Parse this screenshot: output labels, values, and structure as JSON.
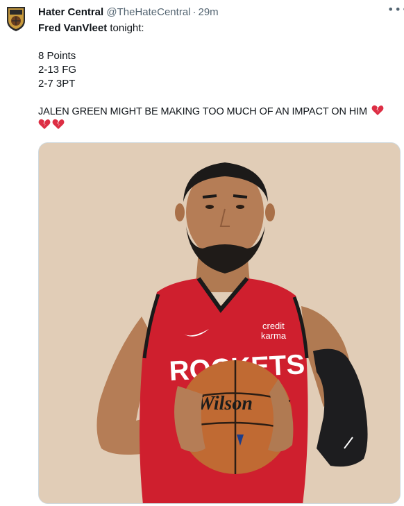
{
  "author": {
    "display_name": "Hater Central",
    "handle": "@TheHateCentral",
    "separator": "·",
    "time": "29m"
  },
  "tweet": {
    "player": "Fred VanVleet",
    "after_player": " tonight:",
    "stats": [
      "8 Points",
      "2-13 FG",
      "2-7 3PT"
    ],
    "shout": "JALEN GREEN MIGHT BE MAKING TOO MUCH OF AN IMPACT ON HIM"
  },
  "icons": {
    "avatar": "hater-central-shield-icon",
    "more": "more-options-icon",
    "emoji": "broken-heart-icon"
  },
  "photo": {
    "jersey_sponsor": [
      "credit",
      "karma"
    ],
    "jersey_text": "ROCKETS",
    "ball_brand": "Wilson"
  },
  "colors": {
    "text": "#0f1419",
    "secondary": "#536471",
    "jersey_red": "#cf1f2e",
    "broken_heart": "#dd2e44"
  }
}
